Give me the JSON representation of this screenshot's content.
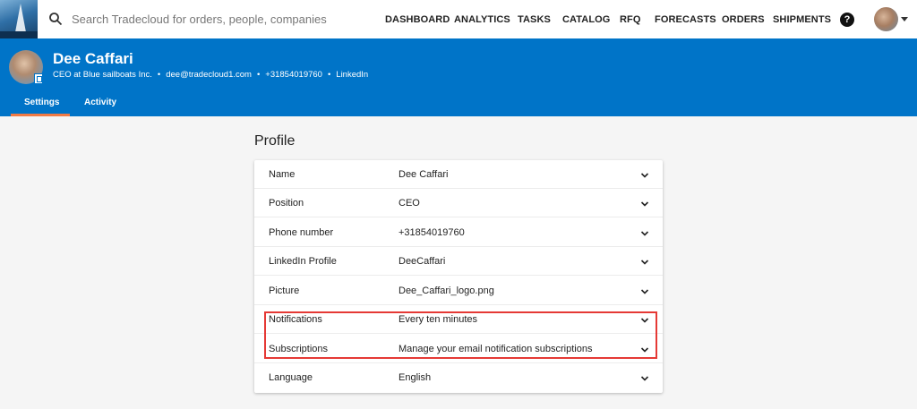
{
  "search": {
    "placeholder": "Search Tradecloud for orders, people, companies"
  },
  "nav": {
    "dashboard": "DASHBOARD",
    "analytics": "ANALYTICS",
    "tasks": "TASKS",
    "catalog": "CATALOG",
    "rfq": "RFQ",
    "forecasts": "FORECASTS",
    "orders": "ORDERS",
    "shipments": "SHIPMENTS",
    "help": "?"
  },
  "header": {
    "name": "Dee Caffari",
    "meta": [
      "CEO at Blue sailboats Inc.",
      "dee@tradecloud1.com",
      "+31854019760",
      "LinkedIn"
    ],
    "tabs": [
      "Settings",
      "Activity"
    ]
  },
  "profile": {
    "title": "Profile",
    "rows": [
      {
        "label": "Name",
        "value": "Dee Caffari"
      },
      {
        "label": "Position",
        "value": "CEO"
      },
      {
        "label": "Phone number",
        "value": "+31854019760"
      },
      {
        "label": "LinkedIn Profile",
        "value": "DeeCaffari"
      },
      {
        "label": "Picture",
        "value": "Dee_Caffari_logo.png"
      },
      {
        "label": "Notifications",
        "value": "Every ten minutes"
      },
      {
        "label": "Subscriptions",
        "value": "Manage your email notification subscriptions"
      },
      {
        "label": "Language",
        "value": "English"
      }
    ]
  },
  "icons": {
    "search": "search-icon",
    "help": "help-icon",
    "chevron": "chevron-down-icon",
    "badge": "linkedin-badge-icon"
  },
  "colors": {
    "header": "#0074c8",
    "tab_underline": "#f07a45",
    "highlight": "#e53935"
  }
}
